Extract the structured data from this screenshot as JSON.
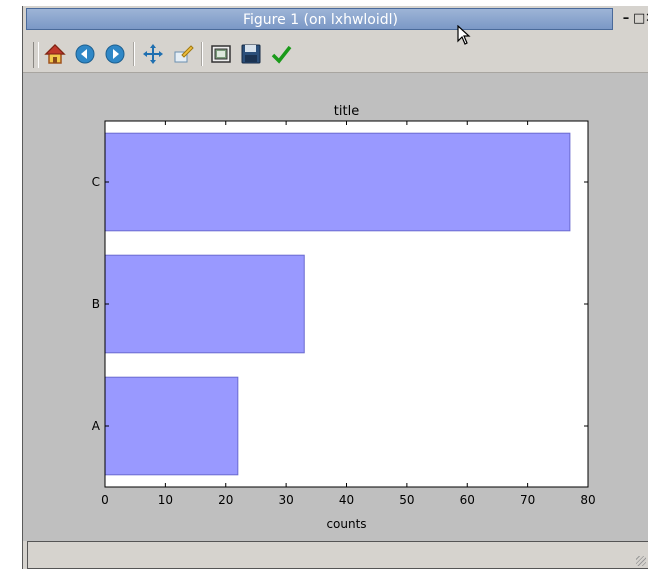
{
  "window": {
    "title": "Figure 1 (on lxhwloidl)",
    "minimize_glyph": "–",
    "maximize_glyph": "□",
    "close_glyph": "✕"
  },
  "toolbar": {
    "buttons": [
      {
        "name": "home-button",
        "icon": "home-icon"
      },
      {
        "name": "back-button",
        "icon": "back-arrow-icon"
      },
      {
        "name": "forward-button",
        "icon": "forward-arrow-icon"
      },
      {
        "name": "pan-button",
        "icon": "pan-move-icon"
      },
      {
        "name": "zoom-button",
        "icon": "zoom-rect-icon"
      },
      {
        "name": "configure-subplots-button",
        "icon": "subplots-icon"
      },
      {
        "name": "save-button",
        "icon": "floppy-save-icon"
      },
      {
        "name": "edit-parameters-button",
        "icon": "checkmark-icon"
      }
    ]
  },
  "status": {
    "message": ""
  },
  "colors": {
    "bar_fill": "#9999ff",
    "bar_edge": "#6a6ad0",
    "canvas_bg": "#bfbfbf",
    "titlebar": "#8aa4cf"
  },
  "chart_data": {
    "type": "bar",
    "orientation": "horizontal",
    "title": "title",
    "xlabel": "counts",
    "ylabel": "",
    "categories": [
      "A",
      "B",
      "C"
    ],
    "values": [
      22,
      33,
      77
    ],
    "xlim": [
      0,
      80
    ],
    "xticks": [
      0,
      10,
      20,
      30,
      40,
      50,
      60,
      70,
      80
    ],
    "grid": false,
    "legend": "none"
  }
}
